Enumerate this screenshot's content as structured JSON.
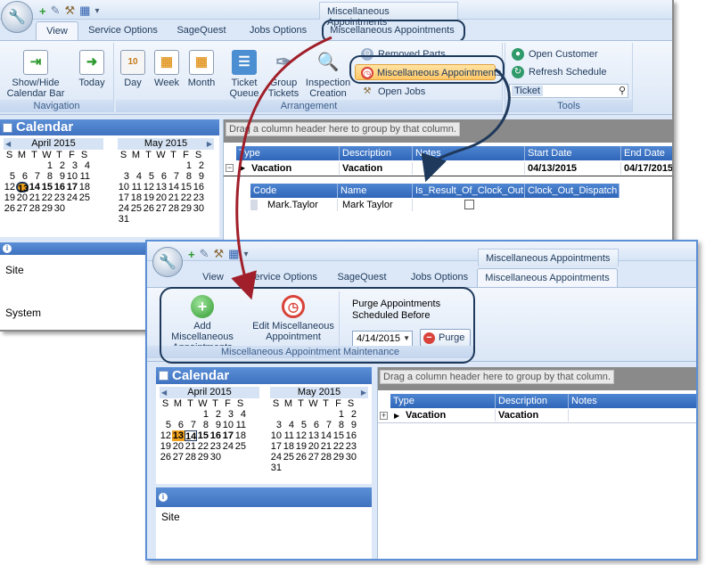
{
  "weekdays": [
    "S",
    "M",
    "T",
    "W",
    "T",
    "F",
    "S"
  ],
  "april_days": [
    "",
    "",
    "",
    "1",
    "2",
    "3",
    "4",
    "5",
    "6",
    "7",
    "8",
    "9",
    "10",
    "11",
    "12",
    "13",
    "14",
    "15",
    "16",
    "17",
    "18",
    "19",
    "20",
    "21",
    "22",
    "23",
    "24",
    "25",
    "26",
    "27",
    "28",
    "29",
    "30"
  ],
  "may_days": [
    "",
    "",
    "",
    "",
    "",
    "1",
    "2",
    "3",
    "4",
    "5",
    "6",
    "7",
    "8",
    "9",
    "10",
    "11",
    "12",
    "13",
    "14",
    "15",
    "16",
    "17",
    "18",
    "19",
    "20",
    "21",
    "22",
    "23",
    "24",
    "25",
    "26",
    "27",
    "28",
    "29",
    "30",
    "31"
  ],
  "colors": {
    "accent_blue": "#3f72c0",
    "today_orange": "#f0a21f",
    "arrow_red": "#a01f2a",
    "arrow_navy": "#1e395b",
    "highlight": "#ffc766"
  },
  "win1": {
    "context_title": "Miscellaneous Appointments",
    "tabs": [
      "View",
      "Service Options",
      "SageQuest",
      "Jobs Options",
      "Miscellaneous Appointments"
    ],
    "ribbon": {
      "navigation": {
        "label": "Navigation",
        "show_hide": "Show/Hide Calendar Bar",
        "today": "Today"
      },
      "arrangement": {
        "label": "Arrangement",
        "day": "Day",
        "week": "Week",
        "month": "Month",
        "ticket_queue": "Ticket Queue",
        "group_tickets": "Group Tickets",
        "inspection_creation": "Inspection Creation",
        "removed_parts": "Removed Parts",
        "misc_appointments": "Miscellaneous Appointments",
        "open_jobs": "Open Jobs"
      },
      "tools": {
        "label": "Tools",
        "open_customer": "Open Customer",
        "refresh_schedule": "Refresh Schedule",
        "ticket_label": "Ticket"
      }
    },
    "calendar": {
      "title": "Calendar",
      "april": "April 2015",
      "may": "May 2015"
    },
    "info": {
      "site": "Site",
      "system": "System"
    },
    "grid": {
      "group_hint": "Drag a column header here to group by that column.",
      "headers": [
        "Type",
        "Description",
        "Notes",
        "Start Date",
        "End Date"
      ],
      "row": {
        "type": "Vacation",
        "description": "Vacation",
        "notes": "",
        "start": "04/13/2015",
        "end": "04/17/2015"
      },
      "sub_headers": [
        "Code",
        "Name",
        "Is_Result_Of_Clock_Out",
        "Clock_Out_Dispatch"
      ],
      "sub_row": {
        "code": "Mark.Taylor",
        "name": "Mark Taylor"
      }
    }
  },
  "win2": {
    "context_title": "Miscellaneous Appointments",
    "tabs": [
      "View",
      "Service Options",
      "SageQuest",
      "Jobs Options",
      "Miscellaneous Appointments"
    ],
    "ribbon": {
      "add": "Add Miscellaneous Appointments",
      "edit": "Edit Miscellaneous Appointment",
      "purge_label": "Purge Appointments Scheduled Before",
      "purge_date": "4/14/2015",
      "purge_btn": "Purge",
      "group_label": "Miscellaneous Appointment Maintenance"
    },
    "calendar": {
      "title": "Calendar",
      "april": "April 2015",
      "may": "May 2015"
    },
    "info": {
      "site": "Site"
    },
    "grid": {
      "group_hint": "Drag a column header here to group by that column.",
      "headers": [
        "Type",
        "Description",
        "Notes"
      ],
      "row": {
        "type": "Vacation",
        "description": "Vacation",
        "notes": ""
      }
    }
  }
}
